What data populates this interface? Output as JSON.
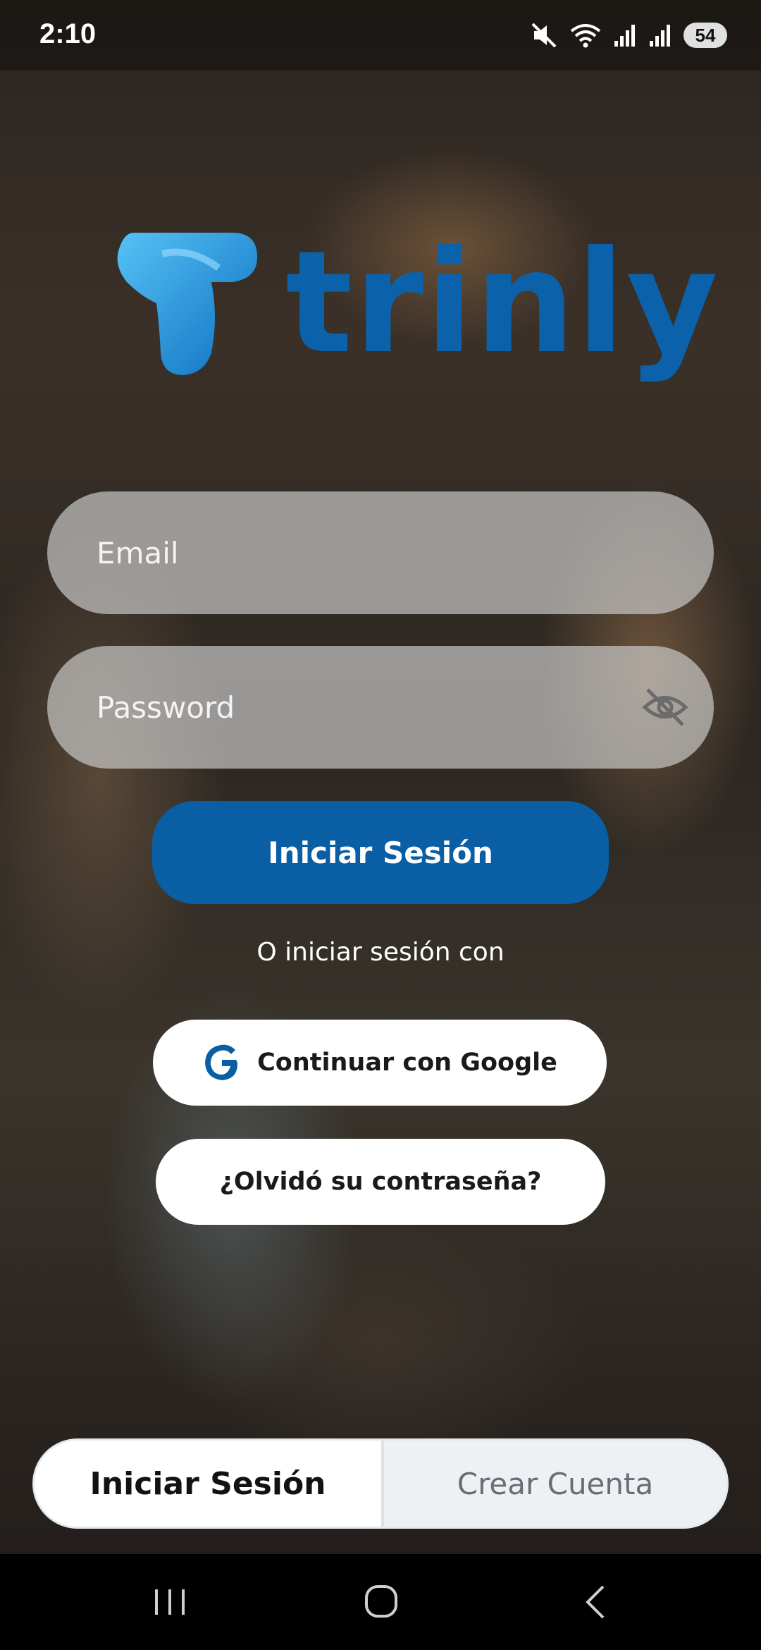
{
  "status_bar": {
    "time": "2:10",
    "battery": "54",
    "icons": [
      "mute-icon",
      "wifi-icon",
      "signal-icon",
      "signal-icon",
      "battery-icon"
    ]
  },
  "brand": {
    "name": "trinly",
    "color": "#0b62aa"
  },
  "form": {
    "email_placeholder": "Email",
    "password_placeholder": "Password",
    "submit_label": "Iniciar Sesión",
    "alt_text": "O iniciar sesión con",
    "google_label": "Continuar con Google",
    "forgot_label": "¿Olvidó su contraseña?"
  },
  "tabs": {
    "login_label": "Iniciar Sesión",
    "register_label": "Crear Cuenta",
    "active": "login"
  },
  "nav": {
    "icons": [
      "recents-icon",
      "home-icon",
      "back-icon"
    ]
  },
  "colors": {
    "primary": "#0a5ea4",
    "logo_light": "#4fb9f0"
  }
}
